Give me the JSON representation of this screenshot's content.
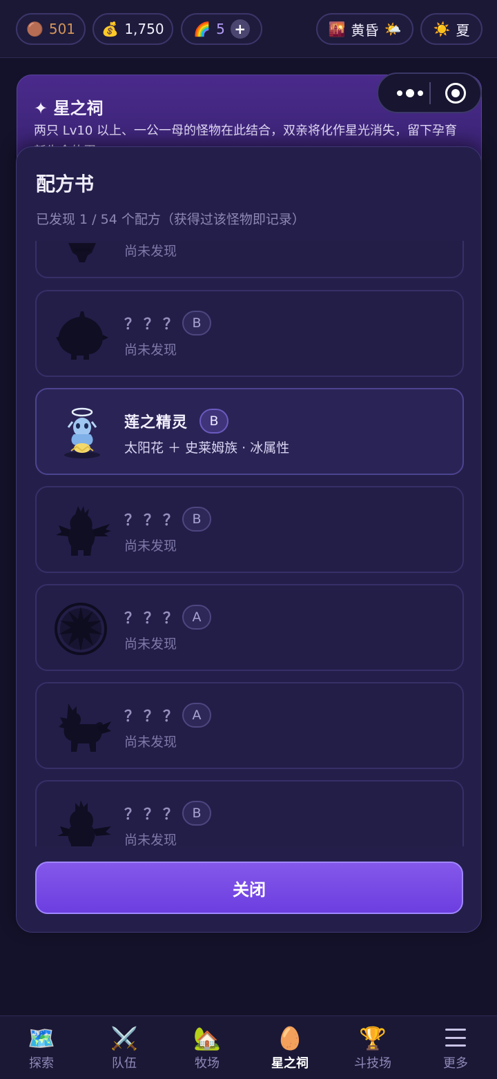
{
  "topbar": {
    "bronze": {
      "icon": "🟤",
      "value": "501"
    },
    "gold": {
      "icon": "💰",
      "value": "1,750"
    },
    "rainbow": {
      "icon": "🌈",
      "value": "5",
      "plus": "+"
    },
    "time": {
      "icon": "🌇",
      "label": "黄昏",
      "weather_icon": "🌤️"
    },
    "season": {
      "icon": "☀️",
      "label": "夏"
    }
  },
  "shrine": {
    "title": "✦ 星之祠",
    "description": "两只 Lv10 以上、一公一母的怪物在此结合，双亲将化作星光消失，留下孕育新生命的蛋"
  },
  "modal": {
    "title": "配方书",
    "subtitle": "已发现 1 / 54 个配方（获得过该怪物即记录）",
    "close_label": "关闭",
    "recipes": [
      {
        "name": "",
        "grade": "",
        "status": "尚未发现",
        "found": false
      },
      {
        "name": "？？？",
        "grade": "B",
        "status": "尚未发现",
        "found": false
      },
      {
        "name": "莲之精灵",
        "grade": "B",
        "status": "太阳花 ＋ 史莱姆族 · 冰属性",
        "found": true
      },
      {
        "name": "？？？",
        "grade": "B",
        "status": "尚未发现",
        "found": false
      },
      {
        "name": "？？？",
        "grade": "A",
        "status": "尚未发现",
        "found": false
      },
      {
        "name": "？？？",
        "grade": "A",
        "status": "尚未发现",
        "found": false
      },
      {
        "name": "？？？",
        "grade": "B",
        "status": "尚未发现",
        "found": false
      }
    ]
  },
  "nav": [
    {
      "icon": "🗺️",
      "label": "探索",
      "active": false
    },
    {
      "icon": "⚔️",
      "label": "队伍",
      "active": false
    },
    {
      "icon": "🏡",
      "label": "牧场",
      "active": false
    },
    {
      "icon": "🥚",
      "label": "星之祠",
      "active": true
    },
    {
      "icon": "🏆",
      "label": "斗技场",
      "active": false
    },
    {
      "icon": "☰",
      "label": "更多",
      "active": false
    }
  ]
}
